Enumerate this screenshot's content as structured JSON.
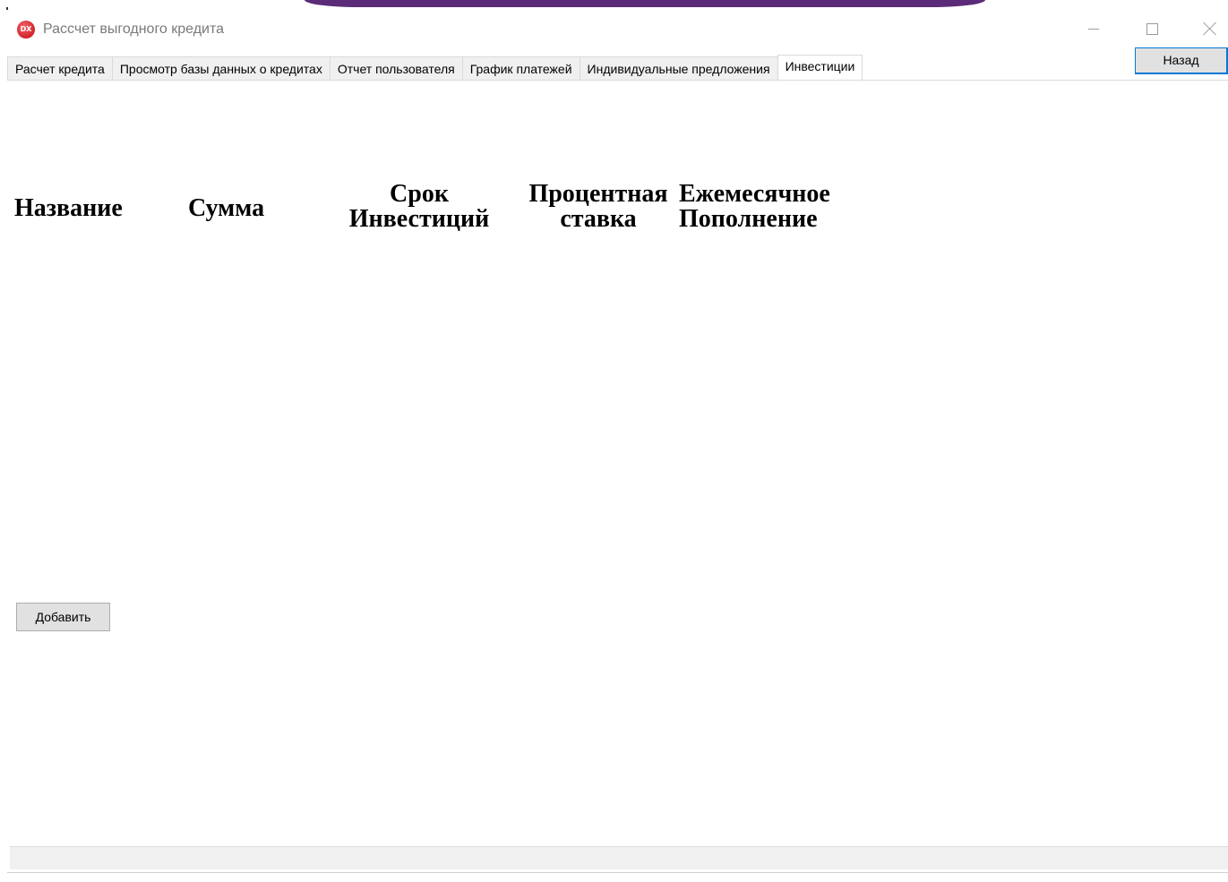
{
  "window": {
    "title": "Рассчет выгодного кредита",
    "app_icon_text": "DX",
    "accent_color": "#5b2b79",
    "icon_color": "#d2232a"
  },
  "tabs": [
    {
      "label": "Расчет кредита",
      "active": false
    },
    {
      "label": "Просмотр базы данных о кредитах",
      "active": false
    },
    {
      "label": "Отчет пользователя",
      "active": false
    },
    {
      "label": "График платежей",
      "active": false
    },
    {
      "label": "Индивидуальные предложения",
      "active": false
    },
    {
      "label": "Инвестиции",
      "active": true
    }
  ],
  "toolbar": {
    "back_label": "Назад"
  },
  "table": {
    "headers": {
      "name": "Название",
      "sum": "Сумма",
      "term_line1": "Срок",
      "term_line2": "Инвестиций",
      "rate_line1": "Процентная",
      "rate_line2": "ставка",
      "monthly_line1": "Ежемесячное",
      "monthly_line2": "Пополнение"
    }
  },
  "actions": {
    "add_label": "Добавить"
  }
}
